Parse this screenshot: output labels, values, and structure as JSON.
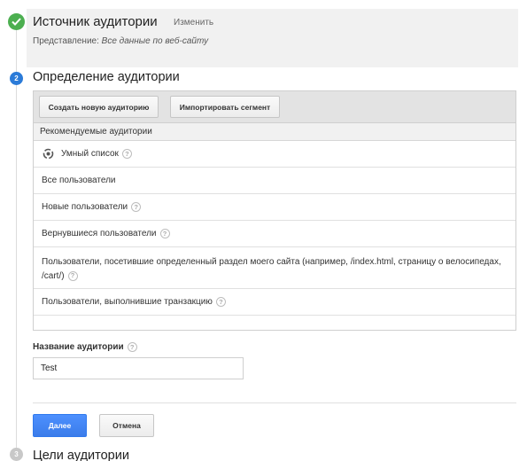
{
  "steps": {
    "step1": {
      "number": "",
      "title": "Источник аудитории",
      "change_label": "Изменить",
      "view_label": "Представление:",
      "view_value": "Все данные по веб-сайту"
    },
    "step2": {
      "number": "2",
      "title": "Определение аудитории"
    },
    "step3": {
      "number": "3",
      "title": "Цели аудитории"
    }
  },
  "panel": {
    "create_button": "Создать новую аудиторию",
    "import_button": "Импортировать сегмент",
    "recommended_header": "Рекомендуемые аудитории",
    "rows": [
      {
        "label": "Умный список",
        "help": "?"
      },
      {
        "label": "Все пользователи"
      },
      {
        "label": "Новые пользователи",
        "help": "?"
      },
      {
        "label": "Вернувшиеся пользователи",
        "help": "?"
      },
      {
        "label": "Пользователи, посетившие определенный раздел моего сайта (например, /index.html, страницу о велосипедах, /cart/)",
        "help": "?"
      },
      {
        "label": "Пользователи, выполнившие транзакцию",
        "help": "?"
      }
    ]
  },
  "audience_name": {
    "label": "Название аудитории",
    "help": "?",
    "value": "Test"
  },
  "actions": {
    "next": "Далее",
    "cancel": "Отмена"
  },
  "colors": {
    "step_done": "#4caf50",
    "step_active": "#2b7bd8",
    "step_inactive": "#c8c8c8",
    "primary_button": "#4d90fe"
  }
}
